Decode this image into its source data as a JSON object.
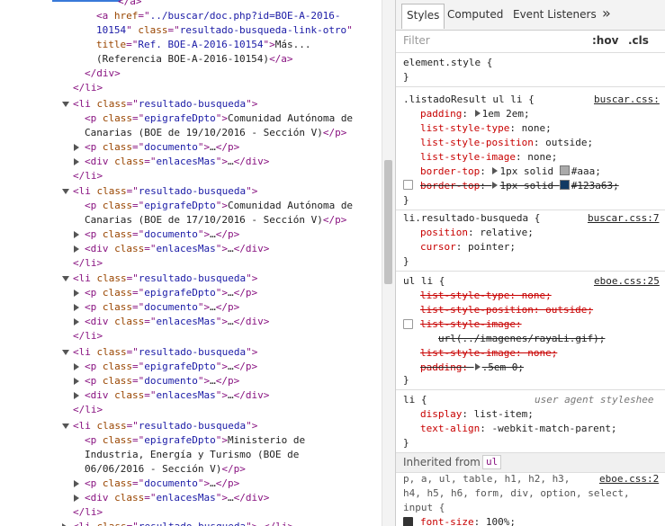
{
  "elements": {
    "lines": [
      {
        "parts": [
          [
            "tag",
            "</a>"
          ]
        ]
      },
      {
        "parts": [
          [
            "tag",
            "<a "
          ],
          [
            "attr",
            "href"
          ],
          [
            "tag",
            "=\""
          ],
          [
            "val",
            "../buscar/doc.php?id=BOE-A-2016-"
          ],
          [
            "tag",
            ""
          ]
        ]
      },
      {
        "parts": [
          [
            "val",
            "10154"
          ],
          [
            "tag",
            "\" "
          ],
          [
            "attr",
            "class"
          ],
          [
            "tag",
            "=\""
          ],
          [
            "val",
            "resultado-busqueda-link-otro"
          ],
          [
            "tag",
            "\""
          ]
        ]
      },
      {
        "parts": [
          [
            "attr",
            "title"
          ],
          [
            "tag",
            "=\""
          ],
          [
            "val",
            "Ref. BOE-A-2016-10154"
          ],
          [
            "tag",
            "\">"
          ],
          [
            "txt",
            "Más..."
          ]
        ]
      },
      {
        "parts": [
          [
            "txt",
            "(Referencia BOE-A-2016-10154)"
          ],
          [
            "tag",
            "</a>"
          ]
        ]
      },
      {
        "parts": [
          [
            "tag",
            "</div>"
          ]
        ]
      },
      {
        "parts": [
          [
            "tag",
            "</li>"
          ]
        ]
      },
      {
        "parts": [
          [
            "tag",
            "<li "
          ],
          [
            "attr",
            "class"
          ],
          [
            "tag",
            "=\""
          ],
          [
            "val",
            "resultado-busqueda"
          ],
          [
            "tag",
            "\">"
          ]
        ]
      },
      {
        "parts": [
          [
            "tag",
            "<p "
          ],
          [
            "attr",
            "class"
          ],
          [
            "tag",
            "=\""
          ],
          [
            "val",
            "epigrafeDpto"
          ],
          [
            "tag",
            "\">"
          ],
          [
            "txt",
            "Comunidad Autónoma de"
          ]
        ]
      },
      {
        "parts": [
          [
            "txt",
            "Canarias (BOE de 19/10/2016 - Sección V)"
          ],
          [
            "tag",
            "</p>"
          ]
        ]
      },
      {
        "parts": [
          [
            "tag",
            "<p "
          ],
          [
            "attr",
            "class"
          ],
          [
            "tag",
            "=\""
          ],
          [
            "val",
            "documento"
          ],
          [
            "tag",
            "\">"
          ],
          [
            "txt",
            "…"
          ],
          [
            "tag",
            "</p>"
          ]
        ]
      },
      {
        "parts": [
          [
            "tag",
            "<div "
          ],
          [
            "attr",
            "class"
          ],
          [
            "tag",
            "=\""
          ],
          [
            "val",
            "enlacesMas"
          ],
          [
            "tag",
            "\">"
          ],
          [
            "txt",
            "…"
          ],
          [
            "tag",
            "</div>"
          ]
        ]
      },
      {
        "parts": [
          [
            "tag",
            "</li>"
          ]
        ]
      },
      {
        "parts": [
          [
            "tag",
            "<li "
          ],
          [
            "attr",
            "class"
          ],
          [
            "tag",
            "=\""
          ],
          [
            "val",
            "resultado-busqueda"
          ],
          [
            "tag",
            "\">"
          ]
        ]
      },
      {
        "parts": [
          [
            "tag",
            "<p "
          ],
          [
            "attr",
            "class"
          ],
          [
            "tag",
            "=\""
          ],
          [
            "val",
            "epigrafeDpto"
          ],
          [
            "tag",
            "\">"
          ],
          [
            "txt",
            "Comunidad Autónoma de"
          ]
        ]
      },
      {
        "parts": [
          [
            "txt",
            "Canarias (BOE de 17/10/2016 - Sección V)"
          ],
          [
            "tag",
            "</p>"
          ]
        ]
      },
      {
        "parts": [
          [
            "tag",
            "<p "
          ],
          [
            "attr",
            "class"
          ],
          [
            "tag",
            "=\""
          ],
          [
            "val",
            "documento"
          ],
          [
            "tag",
            "\">"
          ],
          [
            "txt",
            "…"
          ],
          [
            "tag",
            "</p>"
          ]
        ]
      },
      {
        "parts": [
          [
            "tag",
            "<div "
          ],
          [
            "attr",
            "class"
          ],
          [
            "tag",
            "=\""
          ],
          [
            "val",
            "enlacesMas"
          ],
          [
            "tag",
            "\">"
          ],
          [
            "txt",
            "…"
          ],
          [
            "tag",
            "</div>"
          ]
        ]
      },
      {
        "parts": [
          [
            "tag",
            "</li>"
          ]
        ]
      },
      {
        "parts": [
          [
            "tag",
            "<li "
          ],
          [
            "attr",
            "class"
          ],
          [
            "tag",
            "=\""
          ],
          [
            "val",
            "resultado-busqueda"
          ],
          [
            "tag",
            "\">"
          ]
        ]
      },
      {
        "parts": [
          [
            "tag",
            "<p "
          ],
          [
            "attr",
            "class"
          ],
          [
            "tag",
            "=\""
          ],
          [
            "val",
            "epigrafeDpto"
          ],
          [
            "tag",
            "\">"
          ],
          [
            "txt",
            "…"
          ],
          [
            "tag",
            "</p>"
          ]
        ]
      },
      {
        "parts": [
          [
            "tag",
            "<p "
          ],
          [
            "attr",
            "class"
          ],
          [
            "tag",
            "=\""
          ],
          [
            "val",
            "documento"
          ],
          [
            "tag",
            "\">"
          ],
          [
            "txt",
            "…"
          ],
          [
            "tag",
            "</p>"
          ]
        ]
      },
      {
        "parts": [
          [
            "tag",
            "<div "
          ],
          [
            "attr",
            "class"
          ],
          [
            "tag",
            "=\""
          ],
          [
            "val",
            "enlacesMas"
          ],
          [
            "tag",
            "\">"
          ],
          [
            "txt",
            "…"
          ],
          [
            "tag",
            "</div>"
          ]
        ]
      },
      {
        "parts": [
          [
            "tag",
            "</li>"
          ]
        ]
      },
      {
        "parts": [
          [
            "tag",
            "<li "
          ],
          [
            "attr",
            "class"
          ],
          [
            "tag",
            "=\""
          ],
          [
            "val",
            "resultado-busqueda"
          ],
          [
            "tag",
            "\">"
          ]
        ]
      },
      {
        "parts": [
          [
            "tag",
            "<p "
          ],
          [
            "attr",
            "class"
          ],
          [
            "tag",
            "=\""
          ],
          [
            "val",
            "epigrafeDpto"
          ],
          [
            "tag",
            "\">"
          ],
          [
            "txt",
            "…"
          ],
          [
            "tag",
            "</p>"
          ]
        ]
      },
      {
        "parts": [
          [
            "tag",
            "<p "
          ],
          [
            "attr",
            "class"
          ],
          [
            "tag",
            "=\""
          ],
          [
            "val",
            "documento"
          ],
          [
            "tag",
            "\">"
          ],
          [
            "txt",
            "…"
          ],
          [
            "tag",
            "</p>"
          ]
        ]
      },
      {
        "parts": [
          [
            "tag",
            "<div "
          ],
          [
            "attr",
            "class"
          ],
          [
            "tag",
            "=\""
          ],
          [
            "val",
            "enlacesMas"
          ],
          [
            "tag",
            "\">"
          ],
          [
            "txt",
            "…"
          ],
          [
            "tag",
            "</div>"
          ]
        ]
      },
      {
        "parts": [
          [
            "tag",
            "</li>"
          ]
        ]
      },
      {
        "parts": [
          [
            "tag",
            "<li "
          ],
          [
            "attr",
            "class"
          ],
          [
            "tag",
            "=\""
          ],
          [
            "val",
            "resultado-busqueda"
          ],
          [
            "tag",
            "\">"
          ]
        ]
      },
      {
        "parts": [
          [
            "tag",
            "<p "
          ],
          [
            "attr",
            "class"
          ],
          [
            "tag",
            "=\""
          ],
          [
            "val",
            "epigrafeDpto"
          ],
          [
            "tag",
            "\">"
          ],
          [
            "txt",
            "Ministerio de"
          ]
        ]
      },
      {
        "parts": [
          [
            "txt",
            "Industria, Energía y Turismo (BOE de"
          ]
        ]
      },
      {
        "parts": [
          [
            "txt",
            "06/06/2016 - Sección V)"
          ],
          [
            "tag",
            "</p>"
          ]
        ]
      },
      {
        "parts": [
          [
            "tag",
            "<p "
          ],
          [
            "attr",
            "class"
          ],
          [
            "tag",
            "=\""
          ],
          [
            "val",
            "documento"
          ],
          [
            "tag",
            "\">"
          ],
          [
            "txt",
            "…"
          ],
          [
            "tag",
            "</p>"
          ]
        ]
      },
      {
        "parts": [
          [
            "tag",
            "<div "
          ],
          [
            "attr",
            "class"
          ],
          [
            "tag",
            "=\""
          ],
          [
            "val",
            "enlacesMas"
          ],
          [
            "tag",
            "\">"
          ],
          [
            "txt",
            "…"
          ],
          [
            "tag",
            "</div>"
          ]
        ]
      },
      {
        "parts": [
          [
            "tag",
            "</li>"
          ]
        ]
      },
      {
        "parts": [
          [
            "tag",
            "<li "
          ],
          [
            "attr",
            "class"
          ],
          [
            "tag",
            "=\""
          ],
          [
            "val",
            "resultado-busqueda"
          ],
          [
            "tag",
            "\">"
          ],
          [
            "txt",
            "…"
          ],
          [
            "tag",
            "</li>"
          ]
        ]
      }
    ]
  },
  "styles": {
    "tabs": {
      "styles": "Styles",
      "computed": "Computed",
      "event_listeners": "Event Listeners",
      "more": "»"
    },
    "filter": {
      "placeholder": "Filter",
      "hov": ":hov",
      "cls": ".cls"
    },
    "element_style": {
      "selector": "element.style {",
      "close": "}"
    },
    "rule1": {
      "selector": ".listadoResult ul li {",
      "source": "buscar.css:",
      "padding_prop": "padding",
      "padding_val": "1em 2em;",
      "type_prop": "list-style-type",
      "type_val": "none;",
      "pos_prop": "list-style-position",
      "pos_val": "outside;",
      "img_prop": "list-style-image",
      "img_val": "none;",
      "bt_prop": "border-top",
      "bt_val": "1px solid ",
      "bt_color": "#aaa;",
      "bt_swatch": "#aaaaaa",
      "bt2_prop": "border-top",
      "bt2_val": "1px solid ",
      "bt2_color": "#123a63;",
      "bt2_swatch": "#123a63",
      "close": "}"
    },
    "rule2": {
      "selector": "li.resultado-busqueda {",
      "source": "buscar.css:7",
      "pos_prop": "position",
      "pos_val": "relative;",
      "cur_prop": "cursor",
      "cur_val": "pointer;",
      "close": "}"
    },
    "rule3": {
      "selector": "ul li {",
      "source": "eboe.css:25",
      "type_line": "list-style-type: none;",
      "pos_line": "list-style-position: outside;",
      "img_line": "list-style-image:",
      "url_line": "url(../imagenes/rayaLi.gif);",
      "img2_line": "list-style-image: none;",
      "pad_prop": "padding: ",
      "pad_val": ".5em 0;",
      "close": "}"
    },
    "rule4": {
      "selector": "li {",
      "source": "user agent styleshee",
      "disp_prop": "display",
      "disp_val": "list-item;",
      "ta_prop": "text-align",
      "ta_val": "-webkit-match-parent;",
      "close": "}"
    },
    "inherited": {
      "label": "Inherited from",
      "tag": "ul"
    },
    "rule5": {
      "selector_line1": "p, a, ul, table, h1, h2, h3,",
      "source": "eboe.css:2",
      "selector_line2": "h4, h5, h6, form, div, option, select,",
      "selector_line3": "input {",
      "fs_prop": "font-size",
      "fs_val": "100%;"
    }
  }
}
